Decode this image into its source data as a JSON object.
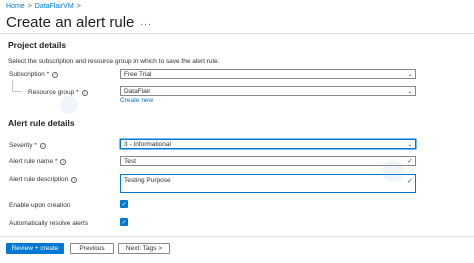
{
  "breadcrumb": {
    "home": "Home",
    "sep1": ">",
    "vm": "DataFlairVM",
    "sep2": ">"
  },
  "page": {
    "title": "Create an alert rule",
    "more": "..."
  },
  "project": {
    "heading": "Project details",
    "description": "Select the subscription and resource group in which to save the alert rule.",
    "subscription_label": "Subscription *",
    "subscription_value": "Free Trial",
    "resource_group_label": "Resource group *",
    "resource_group_value": "DataFlair",
    "create_new": "Create new"
  },
  "alert": {
    "heading": "Alert rule details",
    "severity_label": "Severity *",
    "severity_value": "3 - Informational",
    "name_label": "Alert rule name *",
    "name_value": "Test",
    "desc_label": "Alert rule description",
    "desc_value": "Testing Purpose",
    "enable_label": "Enable upon creation",
    "auto_resolve_label": "Automatically resolve alerts"
  },
  "icons": {
    "info": "i",
    "chevron": "chevron-down-icon",
    "check": "checkmark-icon"
  },
  "footer": {
    "review": "Review + create",
    "previous": "Previous",
    "next": "Next: Tags >"
  },
  "colors": {
    "accent": "#0078d4",
    "valid": "#107c10"
  }
}
